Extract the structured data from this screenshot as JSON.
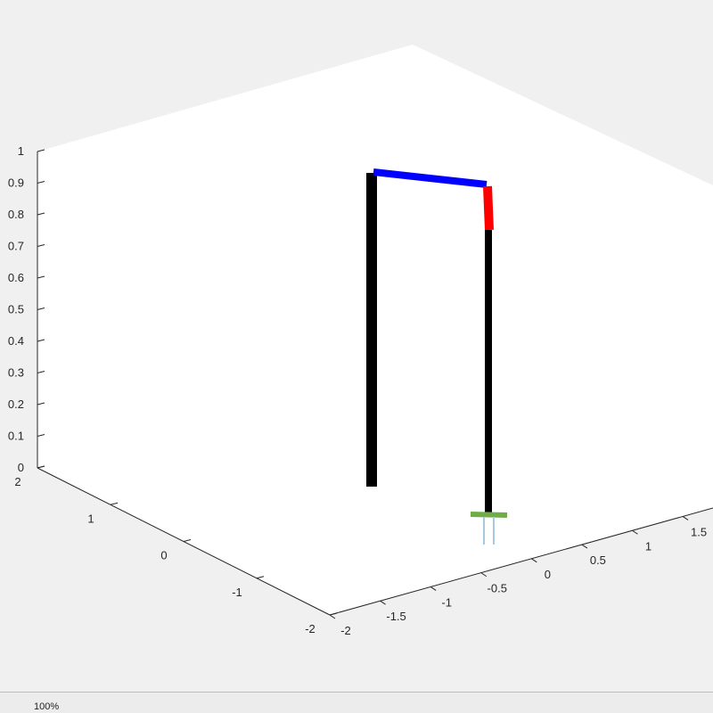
{
  "figure": {
    "background": "#f0f0f0",
    "axes_background": "#ffffff",
    "axis_color": "#262626"
  },
  "status_bar": {
    "zoom_level": "100%"
  },
  "chart_data": {
    "type": "line",
    "projection": "3d",
    "title": "",
    "xlabel": "",
    "ylabel": "",
    "zlabel": "",
    "grid": false,
    "xlim": [
      -2,
      2
    ],
    "ylim": [
      -2,
      2
    ],
    "zlim": [
      0,
      1
    ],
    "x_ticks": [
      "-2",
      "-1.5",
      "-1",
      "-0.5",
      "0",
      "0.5",
      "1",
      "1.5"
    ],
    "y_ticks": [
      "-2",
      "-1",
      "0",
      "1",
      "2"
    ],
    "z_ticks": [
      "0",
      "0.1",
      "0.2",
      "0.3",
      "0.4",
      "0.5",
      "0.6",
      "0.7",
      "0.8",
      "0.9",
      "1"
    ],
    "series": [
      {
        "color": "#000000",
        "segment": "base-column",
        "points": [
          [
            0,
            0,
            0
          ],
          [
            0,
            0,
            0.95
          ]
        ]
      },
      {
        "color": "#0000ff",
        "segment": "upper-arm",
        "points": [
          [
            0,
            0,
            0.95
          ],
          [
            -0.6,
            -0.9,
            0.95
          ]
        ]
      },
      {
        "color": "#ff0000",
        "segment": "forearm",
        "points": [
          [
            -0.6,
            -0.9,
            0.95
          ],
          [
            -0.6,
            -0.9,
            0.82
          ]
        ]
      },
      {
        "color": "#000000",
        "segment": "wrist-link",
        "points": [
          [
            -0.6,
            -0.9,
            0.82
          ],
          [
            -0.6,
            -0.9,
            0.0
          ]
        ]
      },
      {
        "color": "#70ad47",
        "segment": "gripper-base",
        "points": [
          [
            -0.6,
            -0.9,
            0.0
          ]
        ]
      },
      {
        "color": "#a6c8e0",
        "segment": "gripper-fingers",
        "points": [
          [
            -0.6,
            -0.9,
            0.0
          ],
          [
            -0.6,
            -0.9,
            -0.1
          ]
        ]
      }
    ]
  }
}
